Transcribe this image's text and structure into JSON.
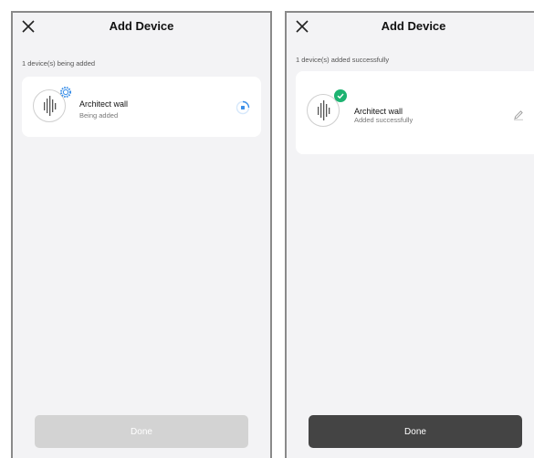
{
  "left_screen": {
    "title": "Add Device",
    "status_text": "1 device(s) being added",
    "device": {
      "name": "Architect wall",
      "status": "Being added"
    },
    "done_label": "Done",
    "done_enabled": false
  },
  "right_screen": {
    "title": "Add Device",
    "status_text": "1 device(s) added successfully",
    "device": {
      "name": "Architect wall",
      "status": "Added successfully"
    },
    "done_label": "Done",
    "done_enabled": true
  },
  "icons": {
    "close": "close-icon",
    "device": "architect-wall-device-icon",
    "pairing_badge": "pairing-gear-icon",
    "success_badge": "check-circle-icon",
    "loading": "loading-spinner-icon",
    "edit": "pencil-icon"
  },
  "colors": {
    "screen_background": "#f3f3f5",
    "card_background": "#ffffff",
    "accent_blue": "#3b8fe8",
    "success_green": "#1db371",
    "done_disabled": "#d3d3d3",
    "done_enabled": "#444444"
  }
}
